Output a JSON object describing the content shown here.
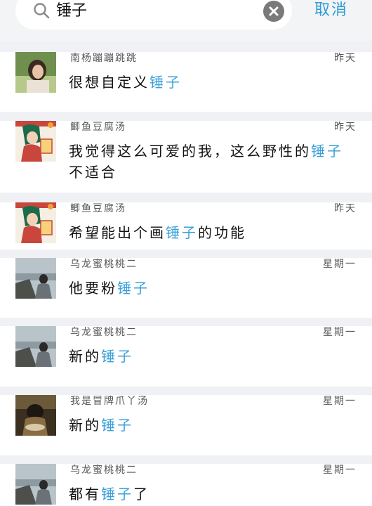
{
  "search": {
    "query": "锤子",
    "cancel_label": "取消"
  },
  "colors": {
    "accent": "#3aa0d8",
    "background": "#f0f1f4"
  },
  "results": [
    {
      "name": "南杨蹦蹦跳跳",
      "time": "昨天",
      "message_before": "很想自定义",
      "message_highlight": "锤子",
      "message_after": "",
      "avatar_icon": "person-photo-avatar"
    },
    {
      "name": "鲫鱼豆腐汤",
      "time": "昨天",
      "message_before": "我觉得这么可爱的我，这么野性的",
      "message_highlight": "锤子",
      "message_after": "不适合",
      "avatar_icon": "cartoon-woman-avatar"
    },
    {
      "name": "鲫鱼豆腐汤",
      "time": "昨天",
      "message_before": "希望能出个画",
      "message_highlight": "锤子",
      "message_after": "的功能",
      "avatar_icon": "cartoon-woman-avatar"
    },
    {
      "name": "乌龙蜜桃桃二",
      "time": "星期一",
      "message_before": "他要粉",
      "message_highlight": "锤子",
      "message_after": "",
      "avatar_icon": "seaside-person-avatar"
    },
    {
      "name": "乌龙蜜桃桃二",
      "time": "星期一",
      "message_before": "新的",
      "message_highlight": "锤子",
      "message_after": "",
      "avatar_icon": "seaside-person-avatar"
    },
    {
      "name": "我是冒牌爪丫汤",
      "time": "星期一",
      "message_before": "新的",
      "message_highlight": "锤子",
      "message_after": "",
      "avatar_icon": "person-eating-avatar"
    },
    {
      "name": "乌龙蜜桃桃二",
      "time": "星期一",
      "message_before": "都有",
      "message_highlight": "锤子",
      "message_after": "了",
      "avatar_icon": "seaside-person-avatar"
    }
  ]
}
